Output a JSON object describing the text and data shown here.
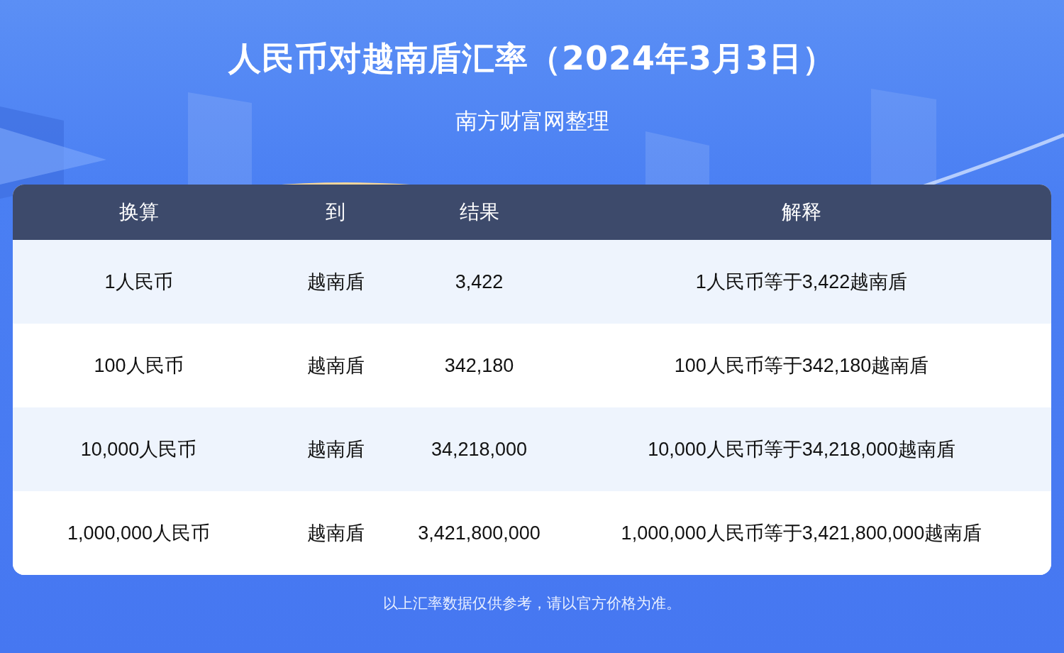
{
  "title": "人民币对越南盾汇率（2024年3月3日）",
  "subtitle": "南方财富网整理",
  "table": {
    "columns": [
      "换算",
      "到",
      "结果",
      "解释"
    ],
    "rows": [
      {
        "cells": [
          "1人民币",
          "越南盾",
          "3,422",
          "1人民币等于3,422越南盾"
        ]
      },
      {
        "cells": [
          "100人民币",
          "越南盾",
          "342,180",
          "100人民币等于342,180越南盾"
        ]
      },
      {
        "cells": [
          "10,000人民币",
          "越南盾",
          "34,218,000",
          "10,000人民币等于34,218,000越南盾"
        ]
      },
      {
        "cells": [
          "1,000,000人民币",
          "越南盾",
          "3,421,800,000",
          "1,000,000人民币等于3,421,800,000越南盾"
        ]
      }
    ]
  },
  "footnote": "以上汇率数据仅供参考，请以官方价格为准。"
}
